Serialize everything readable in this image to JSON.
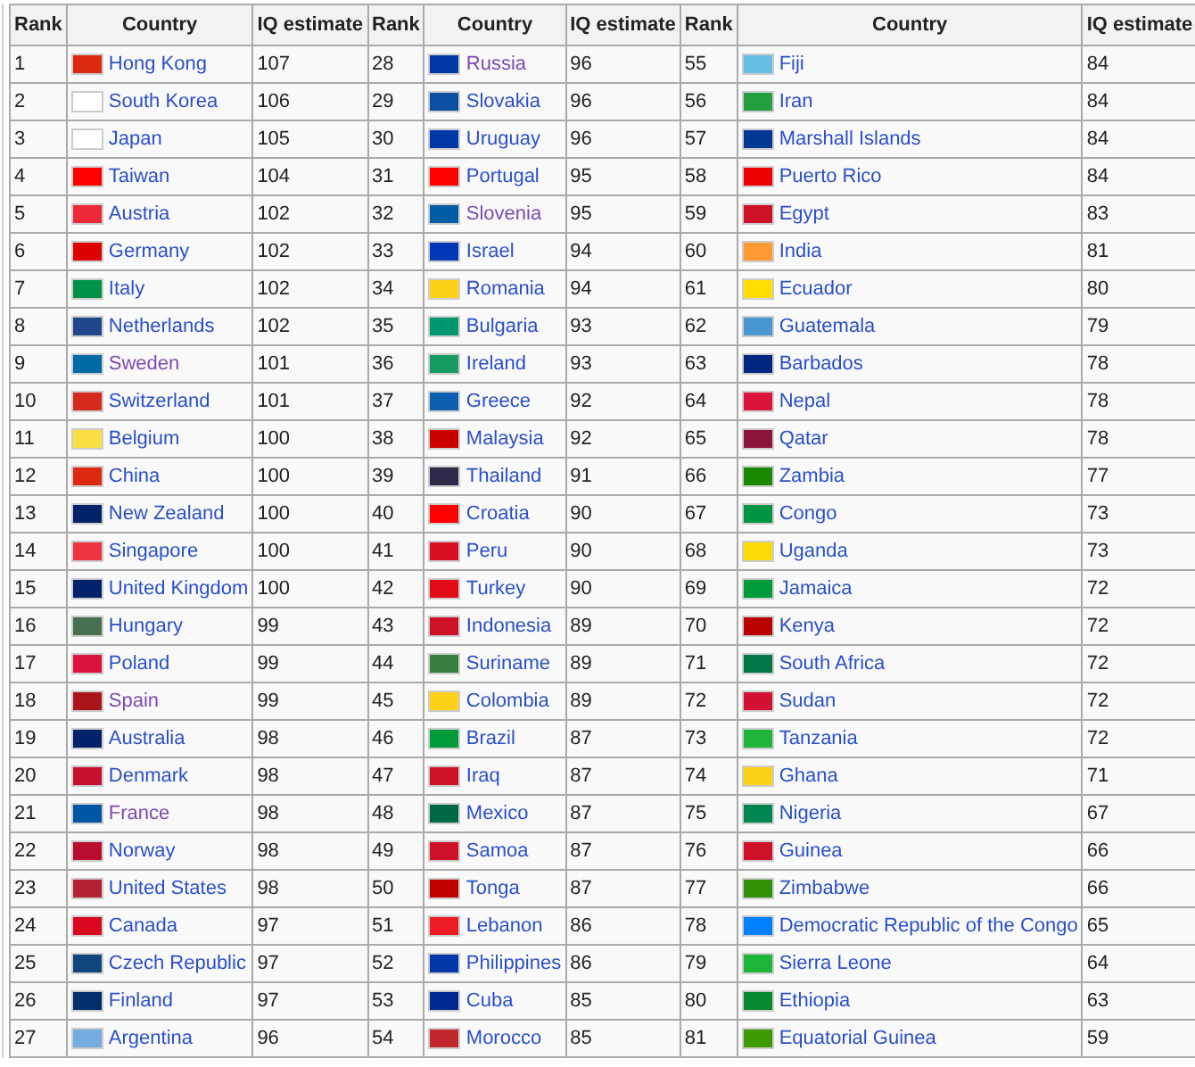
{
  "table": {
    "columns": [
      "Rank",
      "Country",
      "IQ estimate",
      "Rank",
      "Country",
      "IQ estimate",
      "Rank",
      "Country",
      "IQ estimate"
    ],
    "rows": [
      {
        "entries": [
          {
            "rank": "1",
            "country": "Hong Kong",
            "visited": false,
            "color": "#de2910",
            "iq": "107"
          },
          {
            "rank": "28",
            "country": "Russia",
            "visited": true,
            "color": "#0039a6",
            "iq": "96"
          },
          {
            "rank": "55",
            "country": "Fiji",
            "visited": false,
            "color": "#68bfe5",
            "iq": "84"
          }
        ]
      },
      {
        "entries": [
          {
            "rank": "2",
            "country": "South Korea",
            "visited": false,
            "color": "#ffffff",
            "iq": "106"
          },
          {
            "rank": "29",
            "country": "Slovakia",
            "visited": false,
            "color": "#0b4ea2",
            "iq": "96"
          },
          {
            "rank": "56",
            "country": "Iran",
            "visited": false,
            "color": "#239f40",
            "iq": "84"
          }
        ]
      },
      {
        "entries": [
          {
            "rank": "3",
            "country": "Japan",
            "visited": false,
            "color": "#ffffff",
            "iq": "105"
          },
          {
            "rank": "30",
            "country": "Uruguay",
            "visited": false,
            "color": "#0038a8",
            "iq": "96"
          },
          {
            "rank": "57",
            "country": "Marshall Islands",
            "visited": false,
            "color": "#003893",
            "iq": "84"
          }
        ]
      },
      {
        "entries": [
          {
            "rank": "4",
            "country": "Taiwan",
            "visited": false,
            "color": "#fe0000",
            "iq": "104"
          },
          {
            "rank": "31",
            "country": "Portugal",
            "visited": false,
            "color": "#ff0000",
            "iq": "95"
          },
          {
            "rank": "58",
            "country": "Puerto Rico",
            "visited": false,
            "color": "#ed0000",
            "iq": "84"
          }
        ]
      },
      {
        "entries": [
          {
            "rank": "5",
            "country": "Austria",
            "visited": false,
            "color": "#ed2939",
            "iq": "102"
          },
          {
            "rank": "32",
            "country": "Slovenia",
            "visited": true,
            "color": "#005da4",
            "iq": "95"
          },
          {
            "rank": "59",
            "country": "Egypt",
            "visited": false,
            "color": "#ce1126",
            "iq": "83"
          }
        ]
      },
      {
        "entries": [
          {
            "rank": "6",
            "country": "Germany",
            "visited": false,
            "color": "#dd0000",
            "iq": "102"
          },
          {
            "rank": "33",
            "country": "Israel",
            "visited": false,
            "color": "#0038b8",
            "iq": "94"
          },
          {
            "rank": "60",
            "country": "India",
            "visited": false,
            "color": "#ff9933",
            "iq": "81"
          }
        ]
      },
      {
        "entries": [
          {
            "rank": "7",
            "country": "Italy",
            "visited": false,
            "color": "#009246",
            "iq": "102"
          },
          {
            "rank": "34",
            "country": "Romania",
            "visited": false,
            "color": "#fcd116",
            "iq": "94"
          },
          {
            "rank": "61",
            "country": "Ecuador",
            "visited": false,
            "color": "#ffdd00",
            "iq": "80"
          }
        ]
      },
      {
        "entries": [
          {
            "rank": "8",
            "country": "Netherlands",
            "visited": false,
            "color": "#21468b",
            "iq": "102"
          },
          {
            "rank": "35",
            "country": "Bulgaria",
            "visited": false,
            "color": "#00966e",
            "iq": "93"
          },
          {
            "rank": "62",
            "country": "Guatemala",
            "visited": false,
            "color": "#4997d0",
            "iq": "79"
          }
        ]
      },
      {
        "entries": [
          {
            "rank": "9",
            "country": "Sweden",
            "visited": true,
            "color": "#006aa7",
            "iq": "101"
          },
          {
            "rank": "36",
            "country": "Ireland",
            "visited": false,
            "color": "#169b62",
            "iq": "93"
          },
          {
            "rank": "63",
            "country": "Barbados",
            "visited": false,
            "color": "#00267f",
            "iq": "78"
          }
        ]
      },
      {
        "entries": [
          {
            "rank": "10",
            "country": "Switzerland",
            "visited": false,
            "color": "#d52b1e",
            "iq": "101"
          },
          {
            "rank": "37",
            "country": "Greece",
            "visited": false,
            "color": "#0d5eaf",
            "iq": "92"
          },
          {
            "rank": "64",
            "country": "Nepal",
            "visited": false,
            "color": "#dc143c",
            "iq": "78"
          }
        ]
      },
      {
        "entries": [
          {
            "rank": "11",
            "country": "Belgium",
            "visited": false,
            "color": "#fae042",
            "iq": "100"
          },
          {
            "rank": "38",
            "country": "Malaysia",
            "visited": false,
            "color": "#cc0001",
            "iq": "92"
          },
          {
            "rank": "65",
            "country": "Qatar",
            "visited": false,
            "color": "#8a1538",
            "iq": "78"
          }
        ]
      },
      {
        "entries": [
          {
            "rank": "12",
            "country": "China",
            "visited": false,
            "color": "#de2911",
            "iq": "100"
          },
          {
            "rank": "39",
            "country": "Thailand",
            "visited": false,
            "color": "#2d2a4a",
            "iq": "91"
          },
          {
            "rank": "66",
            "country": "Zambia",
            "visited": false,
            "color": "#198a00",
            "iq": "77"
          }
        ]
      },
      {
        "entries": [
          {
            "rank": "13",
            "country": "New Zealand",
            "visited": false,
            "color": "#012169",
            "iq": "100"
          },
          {
            "rank": "40",
            "country": "Croatia",
            "visited": false,
            "color": "#ff0001",
            "iq": "90"
          },
          {
            "rank": "67",
            "country": "Congo",
            "visited": false,
            "color": "#009543",
            "iq": "73"
          }
        ]
      },
      {
        "entries": [
          {
            "rank": "14",
            "country": "Singapore",
            "visited": false,
            "color": "#ef3340",
            "iq": "100"
          },
          {
            "rank": "41",
            "country": "Peru",
            "visited": false,
            "color": "#d91023",
            "iq": "90"
          },
          {
            "rank": "68",
            "country": "Uganda",
            "visited": false,
            "color": "#fcdc04",
            "iq": "73"
          }
        ]
      },
      {
        "entries": [
          {
            "rank": "15",
            "country": "United Kingdom",
            "visited": false,
            "color": "#01216a",
            "iq": "100"
          },
          {
            "rank": "42",
            "country": "Turkey",
            "visited": false,
            "color": "#e30a17",
            "iq": "90"
          },
          {
            "rank": "69",
            "country": "Jamaica",
            "visited": false,
            "color": "#009b3a",
            "iq": "72"
          }
        ]
      },
      {
        "entries": [
          {
            "rank": "16",
            "country": "Hungary",
            "visited": false,
            "color": "#477050",
            "iq": "99"
          },
          {
            "rank": "43",
            "country": "Indonesia",
            "visited": false,
            "color": "#ce1126",
            "iq": "89"
          },
          {
            "rank": "70",
            "country": "Kenya",
            "visited": false,
            "color": "#bb0000",
            "iq": "72"
          }
        ]
      },
      {
        "entries": [
          {
            "rank": "17",
            "country": "Poland",
            "visited": false,
            "color": "#dc143d",
            "iq": "99"
          },
          {
            "rank": "44",
            "country": "Suriname",
            "visited": false,
            "color": "#377e3f",
            "iq": "89"
          },
          {
            "rank": "71",
            "country": "South Africa",
            "visited": false,
            "color": "#007749",
            "iq": "72"
          }
        ]
      },
      {
        "entries": [
          {
            "rank": "18",
            "country": "Spain",
            "visited": true,
            "color": "#aa151b",
            "iq": "99"
          },
          {
            "rank": "45",
            "country": "Colombia",
            "visited": false,
            "color": "#fcd117",
            "iq": "89"
          },
          {
            "rank": "72",
            "country": "Sudan",
            "visited": false,
            "color": "#d21034",
            "iq": "72"
          }
        ]
      },
      {
        "entries": [
          {
            "rank": "19",
            "country": "Australia",
            "visited": false,
            "color": "#01226a",
            "iq": "98"
          },
          {
            "rank": "46",
            "country": "Brazil",
            "visited": false,
            "color": "#009c3b",
            "iq": "87"
          },
          {
            "rank": "73",
            "country": "Tanzania",
            "visited": false,
            "color": "#1eb53a",
            "iq": "72"
          }
        ]
      },
      {
        "entries": [
          {
            "rank": "20",
            "country": "Denmark",
            "visited": false,
            "color": "#c8102e",
            "iq": "98"
          },
          {
            "rank": "47",
            "country": "Iraq",
            "visited": false,
            "color": "#ce1127",
            "iq": "87"
          },
          {
            "rank": "74",
            "country": "Ghana",
            "visited": false,
            "color": "#fcd118",
            "iq": "71"
          }
        ]
      },
      {
        "entries": [
          {
            "rank": "21",
            "country": "France",
            "visited": true,
            "color": "#0055a4",
            "iq": "98"
          },
          {
            "rank": "48",
            "country": "Mexico",
            "visited": false,
            "color": "#006847",
            "iq": "87"
          },
          {
            "rank": "75",
            "country": "Nigeria",
            "visited": false,
            "color": "#008751",
            "iq": "67"
          }
        ]
      },
      {
        "entries": [
          {
            "rank": "22",
            "country": "Norway",
            "visited": false,
            "color": "#ba0c2f",
            "iq": "98"
          },
          {
            "rank": "49",
            "country": "Samoa",
            "visited": false,
            "color": "#ce1128",
            "iq": "87"
          },
          {
            "rank": "76",
            "country": "Guinea",
            "visited": false,
            "color": "#ce1129",
            "iq": "66"
          }
        ]
      },
      {
        "entries": [
          {
            "rank": "23",
            "country": "United States",
            "visited": false,
            "color": "#b22234",
            "iq": "98"
          },
          {
            "rank": "50",
            "country": "Tonga",
            "visited": false,
            "color": "#c10000",
            "iq": "87"
          },
          {
            "rank": "77",
            "country": "Zimbabwe",
            "visited": false,
            "color": "#319208",
            "iq": "66"
          }
        ]
      },
      {
        "entries": [
          {
            "rank": "24",
            "country": "Canada",
            "visited": false,
            "color": "#d80621",
            "iq": "97"
          },
          {
            "rank": "51",
            "country": "Lebanon",
            "visited": false,
            "color": "#ed1c24",
            "iq": "86"
          },
          {
            "rank": "78",
            "country": "Democratic Republic of the Congo",
            "visited": false,
            "color": "#007fff",
            "iq": "65"
          }
        ]
      },
      {
        "entries": [
          {
            "rank": "25",
            "country": "Czech Republic",
            "visited": false,
            "color": "#11457e",
            "iq": "97"
          },
          {
            "rank": "52",
            "country": "Philippines",
            "visited": false,
            "color": "#0038a9",
            "iq": "86"
          },
          {
            "rank": "79",
            "country": "Sierra Leone",
            "visited": false,
            "color": "#1eb53b",
            "iq": "64"
          }
        ]
      },
      {
        "entries": [
          {
            "rank": "26",
            "country": "Finland",
            "visited": false,
            "color": "#002f6c",
            "iq": "97"
          },
          {
            "rank": "53",
            "country": "Cuba",
            "visited": false,
            "color": "#002a8f",
            "iq": "85"
          },
          {
            "rank": "80",
            "country": "Ethiopia",
            "visited": false,
            "color": "#078930",
            "iq": "63"
          }
        ]
      },
      {
        "entries": [
          {
            "rank": "27",
            "country": "Argentina",
            "visited": false,
            "color": "#74acdf",
            "iq": "96"
          },
          {
            "rank": "54",
            "country": "Morocco",
            "visited": false,
            "color": "#c1272d",
            "iq": "85"
          },
          {
            "rank": "81",
            "country": "Equatorial Guinea",
            "visited": false,
            "color": "#3e9a00",
            "iq": "59"
          }
        ]
      }
    ]
  }
}
